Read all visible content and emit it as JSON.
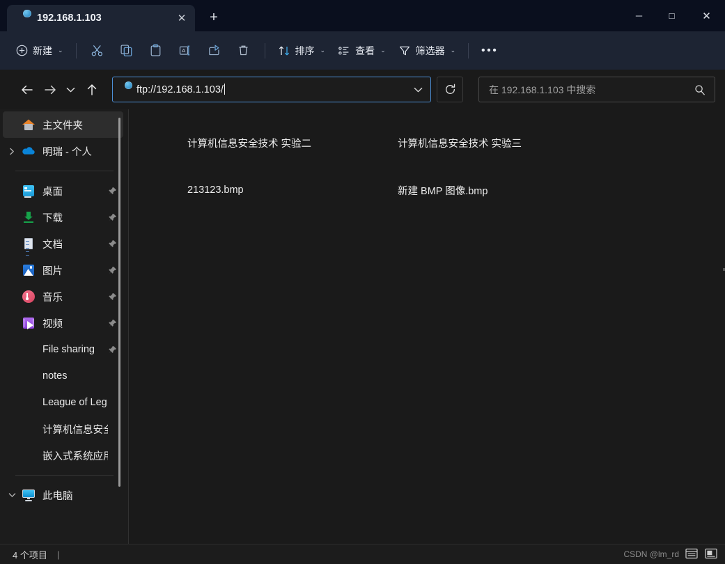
{
  "window": {
    "controls": {
      "minimize": "─",
      "maximize": "□",
      "close": "✕"
    }
  },
  "tabs": [
    {
      "title": "192.168.1.103",
      "icon": "ftp-folder-globe-icon",
      "close_label": "✕",
      "active": true
    }
  ],
  "newtab_label": "+",
  "toolbar": {
    "new_label": "新建",
    "new_icon": "plus-circle-icon",
    "cut_icon": "scissors-icon",
    "copy_icon": "copy-icon",
    "paste_icon": "paste-icon",
    "rename_icon": "rename-icon",
    "share_icon": "share-icon",
    "delete_icon": "trash-icon",
    "sort_label": "排序",
    "sort_icon": "sort-arrows-icon",
    "view_label": "查看",
    "view_icon": "view-list-icon",
    "filter_label": "筛选器",
    "filter_icon": "funnel-icon",
    "more_label": "•••",
    "chevron": "⌄"
  },
  "navigation": {
    "back_icon": "arrow-left-icon",
    "forward_icon": "arrow-right-icon",
    "recent_icon": "chevron-down-icon",
    "up_icon": "arrow-up-icon",
    "address_value": "ftp://192.168.1.103/",
    "address_icon": "ftp-site-icon",
    "address_dropdown_icon": "chevron-down-icon",
    "refresh_icon": "refresh-icon"
  },
  "search": {
    "placeholder": "在 192.168.1.103 中搜索",
    "icon": "search-icon"
  },
  "sidebar": {
    "groups": [
      {
        "items": [
          {
            "label": "主文件夹",
            "icon": "home-icon",
            "selected": true,
            "expander": false,
            "pinned": false
          },
          {
            "label": "明瑞 - 个人",
            "icon": "onedrive-cloud-icon",
            "selected": false,
            "expander": true,
            "pinned": false
          }
        ]
      },
      {
        "items": [
          {
            "label": "桌面",
            "icon": "desktop-icon",
            "selected": false,
            "expander": false,
            "pinned": true
          },
          {
            "label": "下载",
            "icon": "downloads-icon",
            "selected": false,
            "expander": false,
            "pinned": true
          },
          {
            "label": "文档",
            "icon": "documents-icon",
            "selected": false,
            "expander": false,
            "pinned": true
          },
          {
            "label": "图片",
            "icon": "pictures-icon",
            "selected": false,
            "expander": false,
            "pinned": true
          },
          {
            "label": "音乐",
            "icon": "music-icon",
            "selected": false,
            "expander": false,
            "pinned": true
          },
          {
            "label": "视频",
            "icon": "videos-icon",
            "selected": false,
            "expander": false,
            "pinned": true
          },
          {
            "label": "File sharing",
            "icon": "folder-icon",
            "selected": false,
            "expander": false,
            "pinned": true
          },
          {
            "label": "notes",
            "icon": "folder-icon",
            "selected": false,
            "expander": false,
            "pinned": false
          },
          {
            "label": "League of Leg",
            "icon": "folder-icon",
            "selected": false,
            "expander": false,
            "pinned": false
          },
          {
            "label": "计算机信息安全",
            "icon": "folder-icon",
            "selected": false,
            "expander": false,
            "pinned": false
          },
          {
            "label": "嵌入式系统应用",
            "icon": "folder-icon",
            "selected": false,
            "expander": false,
            "pinned": false
          }
        ]
      },
      {
        "items": [
          {
            "label": "此电脑",
            "icon": "this-pc-icon",
            "selected": false,
            "expander": true,
            "expanded": true,
            "pinned": false
          }
        ]
      }
    ],
    "pin_glyph": "📌"
  },
  "content": {
    "items": [
      {
        "name": "计算机信息安全技术 实验二",
        "type": "folder"
      },
      {
        "name": "计算机信息安全技术 实验三",
        "type": "folder"
      },
      {
        "name": "213123.bmp",
        "type": "bmp"
      },
      {
        "name": "新建 BMP 图像.bmp",
        "type": "bmp"
      }
    ]
  },
  "statusbar": {
    "item_count": "4 个项目",
    "separator": "|",
    "watermark": "CSDN @lm_rd",
    "view_details_icon": "details-view-icon",
    "view_large_icons_icon": "large-icons-view-icon"
  },
  "colors": {
    "titlebar": "#0a0f1e",
    "toolbar": "#1d2433",
    "content_bg": "#1a1a1a",
    "sidebar_bg": "#1c1c1c",
    "accent_focus": "#4c8fd6",
    "selected_row": "#2d2d2d",
    "folder_yellow": "#f6c35c"
  }
}
